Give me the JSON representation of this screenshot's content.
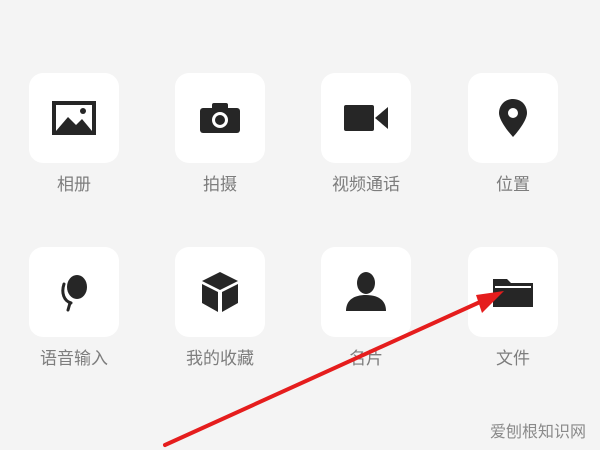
{
  "attachment_menu": {
    "items": [
      {
        "label": "相册",
        "icon": "image-icon"
      },
      {
        "label": "拍摄",
        "icon": "camera-icon"
      },
      {
        "label": "视频通话",
        "icon": "video-camera-icon"
      },
      {
        "label": "位置",
        "icon": "location-pin-icon"
      },
      {
        "label": "语音输入",
        "icon": "microphone-icon"
      },
      {
        "label": "我的收藏",
        "icon": "cube-icon"
      },
      {
        "label": "名片",
        "icon": "contact-card-icon"
      },
      {
        "label": "文件",
        "icon": "folder-icon"
      }
    ]
  },
  "watermark": {
    "text": "爱刨根知识网"
  },
  "colors": {
    "background": "#f4f4f4",
    "tile": "#ffffff",
    "icon": "#262626",
    "label": "#7d7d7d",
    "annotation_arrow": "#e51d1d"
  }
}
